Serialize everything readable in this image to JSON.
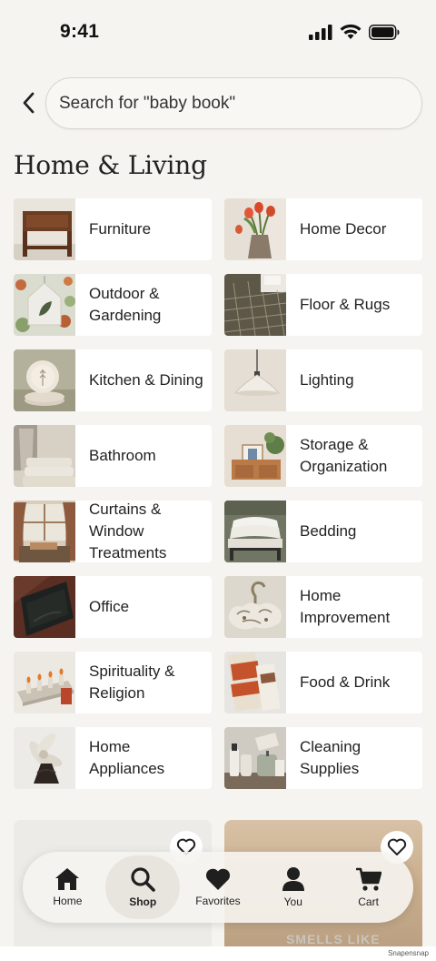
{
  "status_bar": {
    "time": "9:41"
  },
  "search": {
    "placeholder": "Search for \"baby book\""
  },
  "page": {
    "title": "Home & Living"
  },
  "categories": [
    {
      "label": "Furniture",
      "icon": "furniture-thumb"
    },
    {
      "label": "Home Decor",
      "icon": "home-decor-thumb"
    },
    {
      "label": "Outdoor & Gardening",
      "icon": "outdoor-thumb"
    },
    {
      "label": "Floor & Rugs",
      "icon": "rugs-thumb"
    },
    {
      "label": "Kitchen & Dining",
      "icon": "kitchen-thumb"
    },
    {
      "label": "Lighting",
      "icon": "lighting-thumb"
    },
    {
      "label": "Bathroom",
      "icon": "bathroom-thumb"
    },
    {
      "label": "Storage & Organization",
      "icon": "storage-thumb"
    },
    {
      "label": "Curtains & Window Treatments",
      "icon": "curtains-thumb"
    },
    {
      "label": "Bedding",
      "icon": "bedding-thumb"
    },
    {
      "label": "Office",
      "icon": "office-thumb"
    },
    {
      "label": "Home Improvement",
      "icon": "home-improvement-thumb"
    },
    {
      "label": "Spirituality & Religion",
      "icon": "spirituality-thumb"
    },
    {
      "label": "Food & Drink",
      "icon": "food-drink-thumb"
    },
    {
      "label": "Home Appliances",
      "icon": "appliances-thumb"
    },
    {
      "label": "Cleaning Supplies",
      "icon": "cleaning-thumb"
    }
  ],
  "promo": {
    "right_text": "SMELLS LIKE"
  },
  "tabbar": {
    "tabs": [
      {
        "label": "Home",
        "icon": "home-icon"
      },
      {
        "label": "Shop",
        "icon": "search-icon",
        "active": true
      },
      {
        "label": "Favorites",
        "icon": "heart-icon"
      },
      {
        "label": "You",
        "icon": "person-icon"
      },
      {
        "label": "Cart",
        "icon": "cart-icon"
      }
    ]
  },
  "footer": {
    "credit": "Snapensnap"
  },
  "colors": {
    "background": "#f5f4f0",
    "card": "#ffffff",
    "text": "#222222"
  }
}
